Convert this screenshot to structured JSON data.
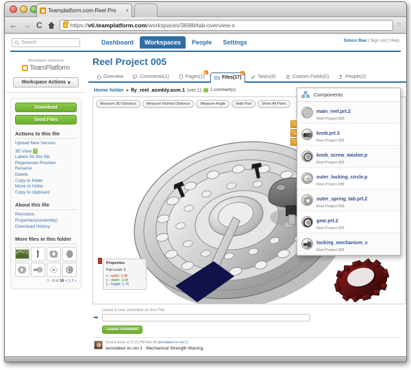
{
  "browser": {
    "tab_title": "Teamplatform.com-Reel Pro",
    "tab_close": "×",
    "back": "←",
    "forward": "→",
    "reload": "C",
    "url_prefix": "https://",
    "url_host": "vti.teamplatform.com",
    "url_path": "/workspaces/3698#tab-overview-s",
    "star": "☆"
  },
  "topnav": {
    "search_placeholder": "Search",
    "menu": [
      {
        "label": "Dashboard",
        "active": false
      },
      {
        "label": "Workspaces",
        "active": true
      },
      {
        "label": "People",
        "active": false
      },
      {
        "label": "Settings",
        "active": false
      }
    ],
    "user": "Simon Bae",
    "signout": "Sign out",
    "help": "Help",
    "sep": "|"
  },
  "sidebar": {
    "owned_by": "Workspace owned by",
    "brand_bold": "Team",
    "brand_light": "Platform",
    "workspace_actions": "Workspace Actions",
    "workspace_actions_caret": "▾",
    "buttons": [
      {
        "label": "Download",
        "name": "download-button"
      },
      {
        "label": "Send Files",
        "name": "send-files-button"
      }
    ],
    "actions_heading": "Actions to this file",
    "actions": [
      "Upload New Version",
      "3D View",
      "Labels for this file",
      "Regenerate Preview",
      "Rename",
      "Delete",
      "Copy to folder",
      "Move to folder",
      "Copy to clipboard"
    ],
    "badge_3d": "?",
    "about_heading": "About this file",
    "about_links": [
      "Revisions",
      "Properties(Assembly)",
      "Download History"
    ],
    "more_files_heading": "More files in this folder",
    "pager": {
      "range": "1 - 8 of ",
      "total": "16",
      "prev": "<",
      "p1": "1",
      "p2": "2",
      "next": ">"
    }
  },
  "main": {
    "project_title": "Reel Project 005",
    "tabs": [
      {
        "label": "Overview",
        "icon": "home-icon",
        "selected": false,
        "rss": false
      },
      {
        "label": "Comments(1)",
        "icon": "comments-icon",
        "selected": false,
        "rss": false
      },
      {
        "label": "Pages(1)",
        "icon": "pages-icon",
        "selected": false,
        "rss": true
      },
      {
        "label": "Files(17)",
        "icon": "folder-icon",
        "selected": true,
        "rss": true
      },
      {
        "label": "Tasks(0)",
        "icon": "check-icon",
        "selected": false,
        "rss": false
      },
      {
        "label": "Custom Fields(0)",
        "icon": "list-icon",
        "selected": false,
        "rss": false
      },
      {
        "label": "People(2)",
        "icon": "person-icon",
        "selected": false,
        "rss": false
      }
    ],
    "breadcrumb": {
      "home": "Home folder",
      "sep": "»",
      "file": "fly_reel_asmbly.asm.1",
      "version": "(ver.1)",
      "comments": "1 comment(s)"
    }
  },
  "viewer": {
    "tools": [
      "Measure 3D Distance",
      "Measure Normal Distance",
      "Measure Angle",
      "Hide Part",
      "Show All Parts"
    ],
    "side_tabs": [
      "T",
      "Tr",
      "V"
    ],
    "properties": {
      "title": "Properties",
      "part_count_label": "Part count:",
      "part_count_value": "9",
      "x_label": "x - width:",
      "x_value": "3.48",
      "y_label": "y - depth:",
      "y_value": "3.48",
      "z_label": "z - height:",
      "z_value": "1.76"
    }
  },
  "components": {
    "title": "Components",
    "items": [
      {
        "name": "main_reel.prt.2",
        "sub": "Reel Project 005",
        "shape": "disc"
      },
      {
        "name": "knob.prt.3",
        "sub": "Reel Project 005",
        "shape": "cylinder"
      },
      {
        "name": "knob_screw_washer.p",
        "sub": "Reel Project 005",
        "shape": "ring"
      },
      {
        "name": "outer_locking_circle.p",
        "sub": "Reel Project 005",
        "shape": "circle"
      },
      {
        "name": "outer_spring_tab.prt.2",
        "sub": "Reel Project 005",
        "shape": "tab"
      },
      {
        "name": "gear.prt.2",
        "sub": "Reel Project 005",
        "shape": "gear"
      },
      {
        "name": "locking_mechanism_s",
        "sub": "Reel Project 005",
        "shape": "bolt"
      }
    ]
  },
  "comments": {
    "placeholder_label": "Leave a new comment on this File",
    "input_value": "",
    "submit": "Leave comment",
    "entry": {
      "meta": "Scott A wrote at 07:21 PM Mar 08",
      "meta_anno": "(annotated on ver.1)",
      "body": "annotated on ver.1 : Mechanical Strength Waning."
    }
  },
  "colors": {
    "brand_blue": "#2f6ea5",
    "green": "#6cae2e",
    "orange": "#f08a1b",
    "gear_red": "#6b1515"
  }
}
